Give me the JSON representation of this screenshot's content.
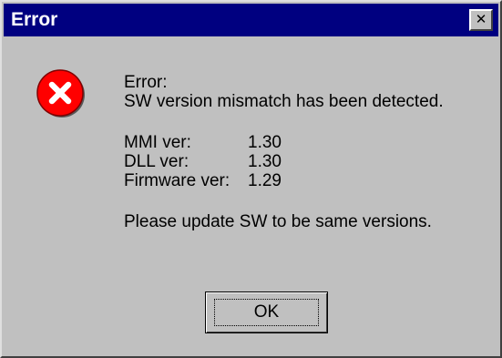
{
  "window": {
    "title": "Error",
    "close_glyph": "✕"
  },
  "icon": {
    "name": "error-icon",
    "color": "#ff0000",
    "glyph_color": "#ffffff"
  },
  "message": {
    "heading": "Error:",
    "detail": "SW version mismatch has been detected.",
    "versions": [
      {
        "label": "MMI ver:",
        "value": "1.30"
      },
      {
        "label": "DLL ver:",
        "value": "1.30"
      },
      {
        "label": "Firmware ver:",
        "value": "1.29"
      }
    ],
    "instruction": "Please update SW to be same versions."
  },
  "buttons": {
    "ok_label": "OK"
  },
  "colors": {
    "titlebar": "#000080",
    "dialog_bg": "#c0c0c0"
  }
}
